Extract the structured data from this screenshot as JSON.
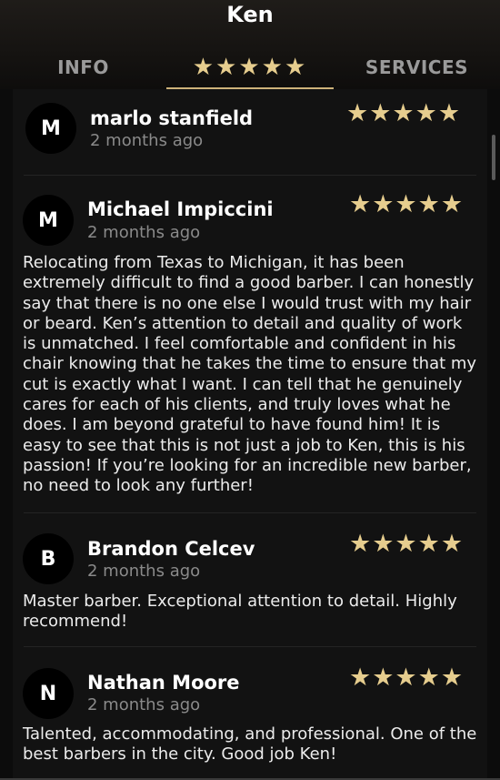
{
  "header": {
    "title": "Ken"
  },
  "tabs": {
    "info": "INFO",
    "reviews": "★★★★★",
    "services": "SERVICES"
  },
  "reviews": [
    {
      "initial": "M",
      "name": "marlo stanfield",
      "time": "2 months ago",
      "stars": "★★★★★",
      "rating": 5,
      "text": ""
    },
    {
      "initial": "M",
      "name": "Michael Impiccini",
      "time": "2 months ago",
      "stars": "★★★★★",
      "rating": 5,
      "text": "Relocating from Texas to Michigan, it has been extremely difficult to find a good barber. I can honestly say that there is no one else I would trust with my hair or beard. Ken’s attention to detail and quality of work is unmatched. I feel comfortable and confident in his chair knowing that he takes the time to ensure that my cut is exactly what I want. I can tell that he genuinely cares for each of his clients, and truly loves what he does. I am beyond grateful to have found him! It is easy to see that this is not just a job to Ken, this is his passion! If you’re looking for an incredible new barber, no need to look any further!"
    },
    {
      "initial": "B",
      "name": "Brandon Celcev",
      "time": "2 months ago",
      "stars": "★★★★★",
      "rating": 5,
      "text": "Master barber. Exceptional attention to detail. Highly recommend!"
    },
    {
      "initial": "N",
      "name": "Nathan Moore",
      "time": "2 months ago",
      "stars": "★★★★★",
      "rating": 5,
      "text": "Talented, accommodating, and professional. One of the best barbers in the city. Good job Ken!"
    }
  ],
  "colors": {
    "accent": "#e6cd8e",
    "background": "#121212",
    "muted": "#8a8a8a"
  }
}
